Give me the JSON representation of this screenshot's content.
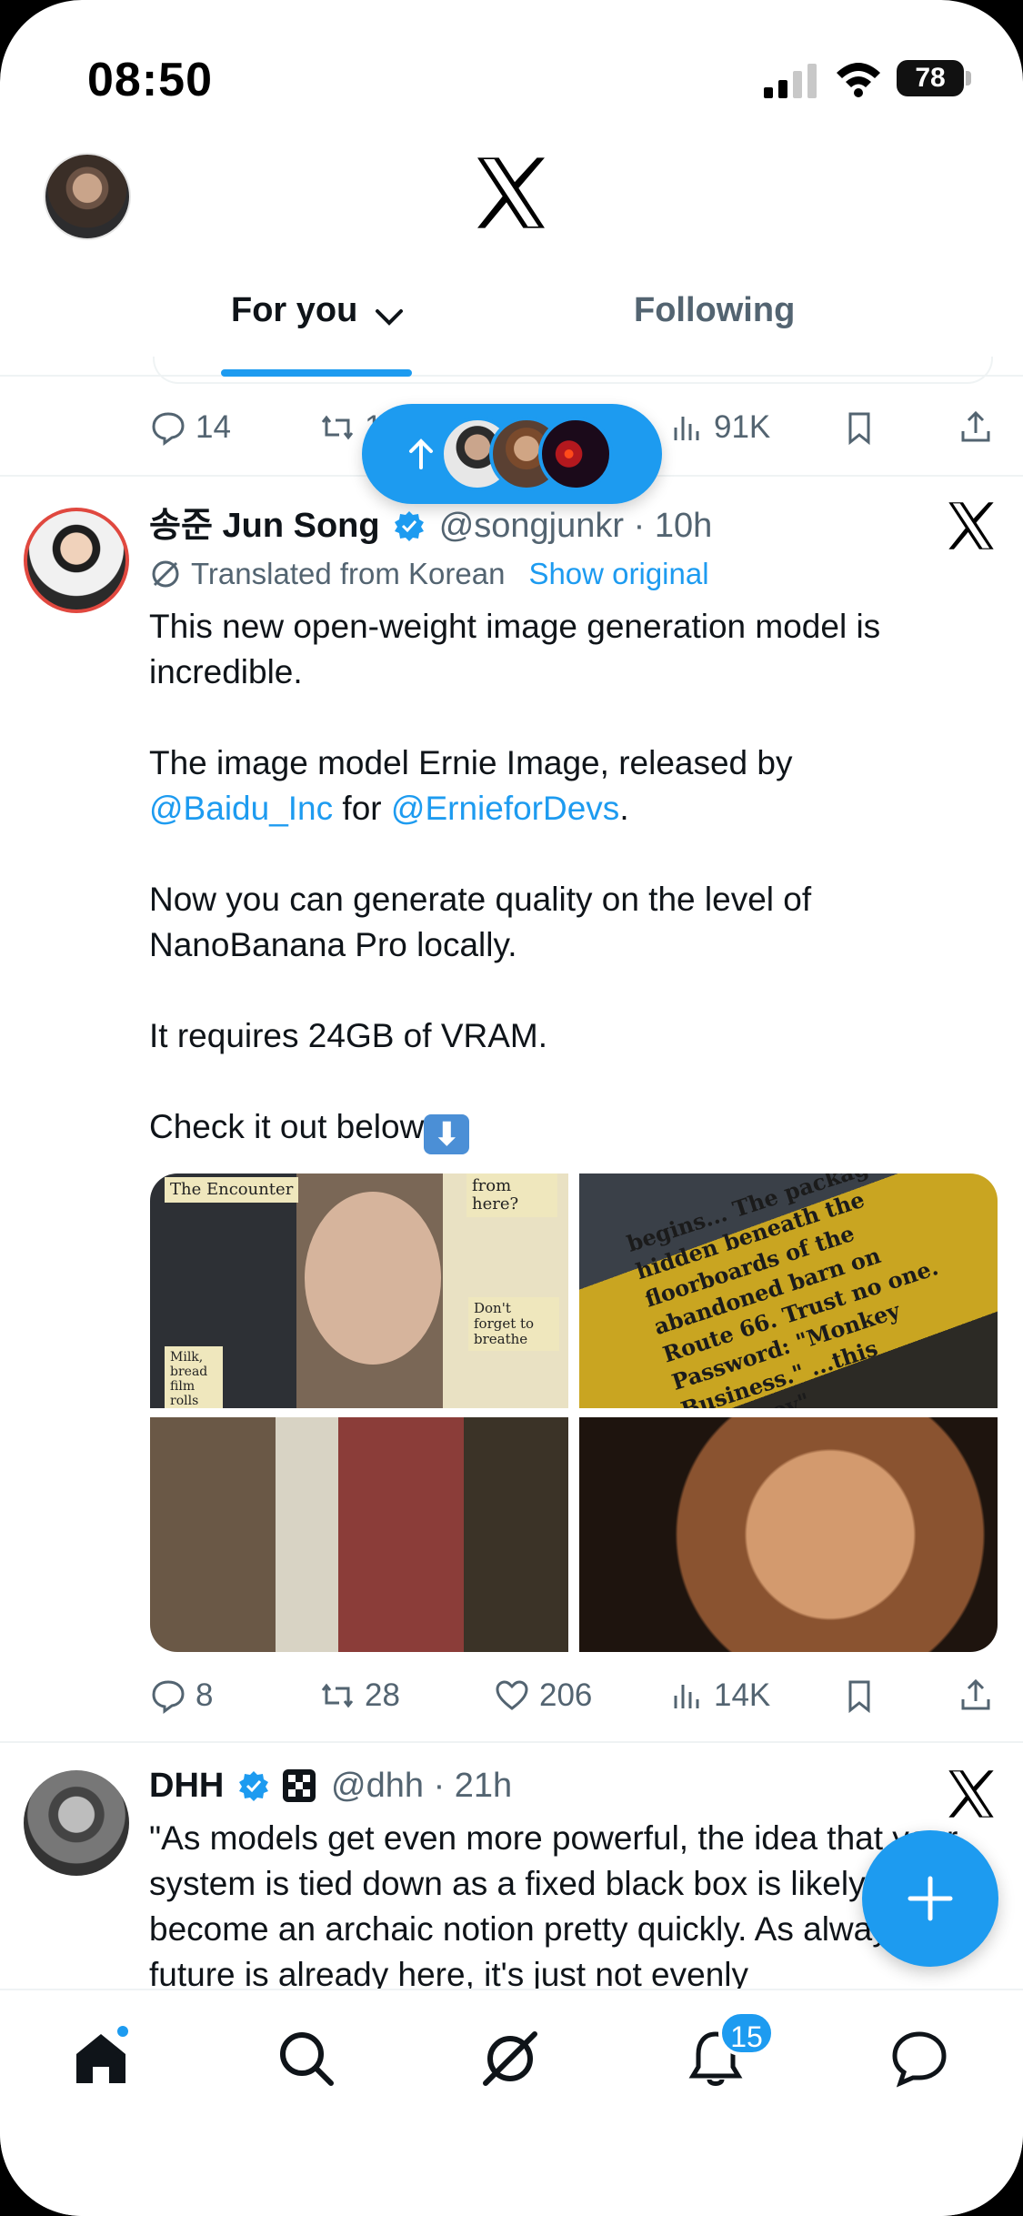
{
  "status_bar": {
    "time": "08:50",
    "battery": "78"
  },
  "header": {
    "tabs": [
      {
        "label": "For you"
      },
      {
        "label": "Following"
      }
    ]
  },
  "prev_actions": {
    "replies": "14",
    "retweets": "1",
    "views": "91K"
  },
  "tweet1": {
    "name": "송준 Jun Song",
    "handle": "@songjunkr",
    "time": "· 10h",
    "translated_label": "Translated from Korean",
    "show_original": "Show original",
    "p1": "This new open-weight image generation model is incredible.",
    "p2_a": "The image model Ernie Image, released by ",
    "p2_link1": "@Baidu_Inc",
    "p2_b": " for ",
    "p2_link2": "@ErnieforDevs",
    "p2_c": ".",
    "p3": "Now you can generate quality on the level of NanoBanana Pro locally.",
    "p4": "It requires 24GB of VRAM.",
    "p5": "Check it out below",
    "emoji": "⬇",
    "media_notes": {
      "encounter": "The Encounter",
      "from_here": "from here?",
      "dont_forget": "Don't forget to breathe",
      "milk": "Milk, bread film rolls",
      "banana": "begins... The package is hidden beneath the floorboards of the abandoned barn on Route 66. Trust no one. Password: \"Monkey Business.\" ...this ...destroy\""
    },
    "actions": {
      "replies": "8",
      "retweets": "28",
      "likes": "206",
      "views": "14K"
    }
  },
  "tweet2": {
    "name": "DHH",
    "handle": "@dhh",
    "time": "· 21h",
    "text": "\"As models get even more powerful, the idea that your system is tied down as a fixed black box is likely to become an archaic notion pretty quickly. As always, the future is already here, it's just not evenly"
  },
  "nav": {
    "notifications_count": "15"
  },
  "colors": {
    "accent": "#1d9bf0",
    "text": "#0f1419",
    "muted": "#536471"
  }
}
